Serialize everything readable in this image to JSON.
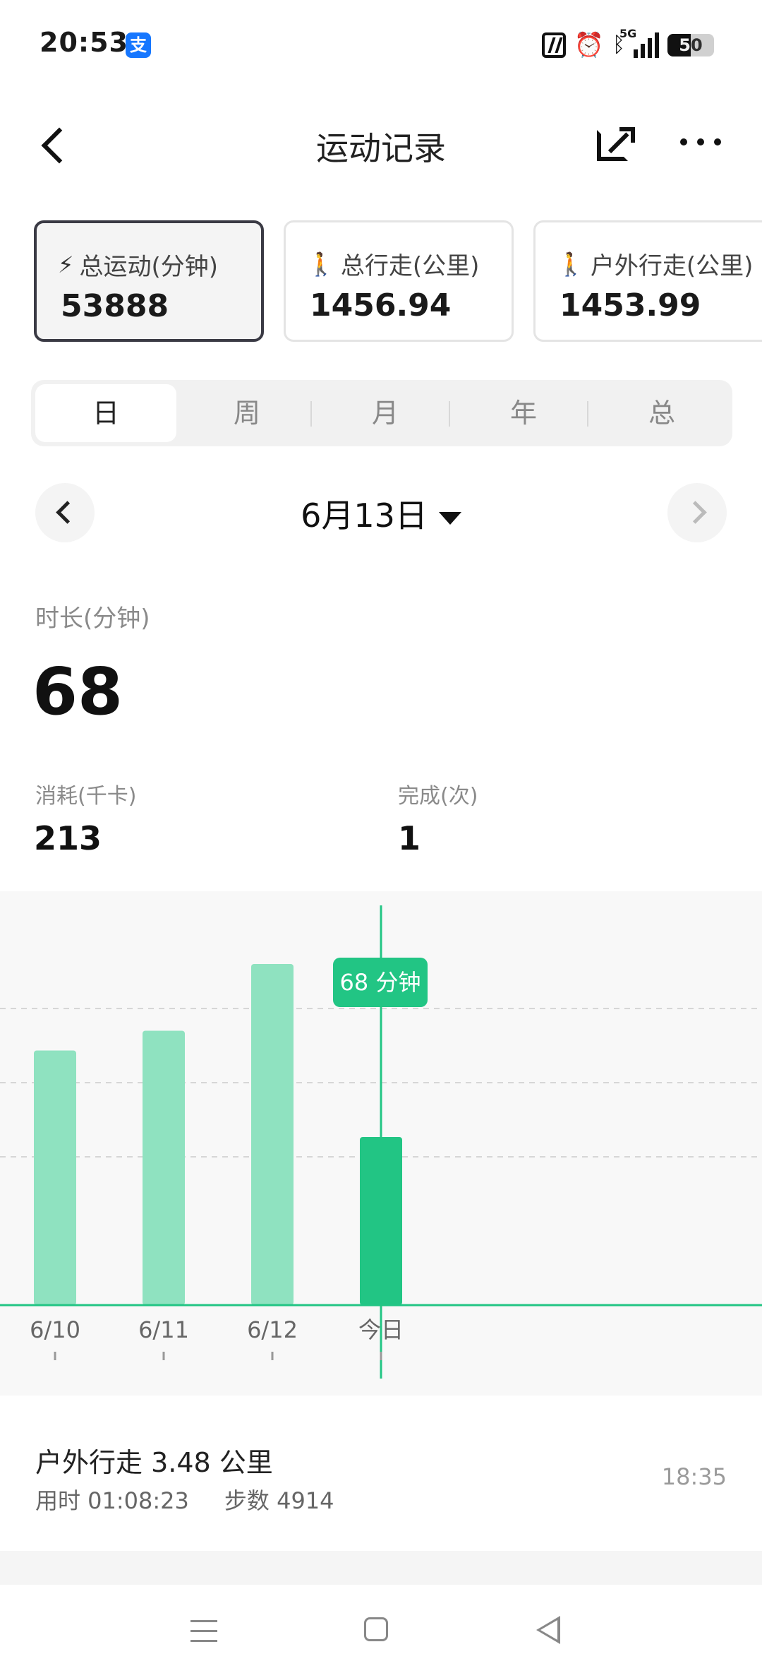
{
  "status_bar": {
    "time": "20:53",
    "alipay_glyph": "支",
    "network": "5G",
    "battery": "50",
    "icons": [
      "nfc-icon",
      "alarm-icon",
      "bluetooth-icon",
      "signal-icon",
      "battery-icon"
    ]
  },
  "header": {
    "title": "运动记录",
    "icons": [
      "back-icon",
      "share-icon",
      "more-icon"
    ]
  },
  "summary_cards": [
    {
      "label": "总运动(分钟)",
      "value": "53888",
      "icon": "lightning-icon",
      "glyph": "⚡",
      "active": true
    },
    {
      "label": "总行走(公里)",
      "value": "1456.94",
      "icon": "walk-icon",
      "glyph": "🚶",
      "active": false
    },
    {
      "label": "户外行走(公里)",
      "value": "1453.99",
      "icon": "walk-icon",
      "glyph": "🚶",
      "active": false
    }
  ],
  "period_tabs": {
    "items": [
      "日",
      "周",
      "月",
      "年",
      "总"
    ],
    "selected": "日"
  },
  "date_nav": {
    "label": "6月13日"
  },
  "stats": {
    "duration_label": "时长(分钟)",
    "duration_value": "68",
    "calories_label": "消耗(千卡)",
    "calories_value": "213",
    "count_label": "完成(次)",
    "count_value": "1"
  },
  "chart_data": {
    "type": "bar",
    "categories": [
      "6/10",
      "6/11",
      "6/12",
      "今日"
    ],
    "values": [
      103,
      111,
      138,
      68
    ],
    "selected_index": 3,
    "tooltip": "68 分钟",
    "ylim": [
      0,
      160
    ],
    "grid": true,
    "colors": {
      "bar": "#8fe2c0",
      "bar_selected": "#22c584",
      "line": "#22c584"
    }
  },
  "activity": {
    "title": "户外行走 3.48 公里",
    "duration": "用时 01:08:23",
    "steps": "步数 4914",
    "time": "18:35"
  },
  "nav_bar": {
    "icons": [
      "menu-icon",
      "home-icon",
      "back-triangle-icon"
    ]
  }
}
